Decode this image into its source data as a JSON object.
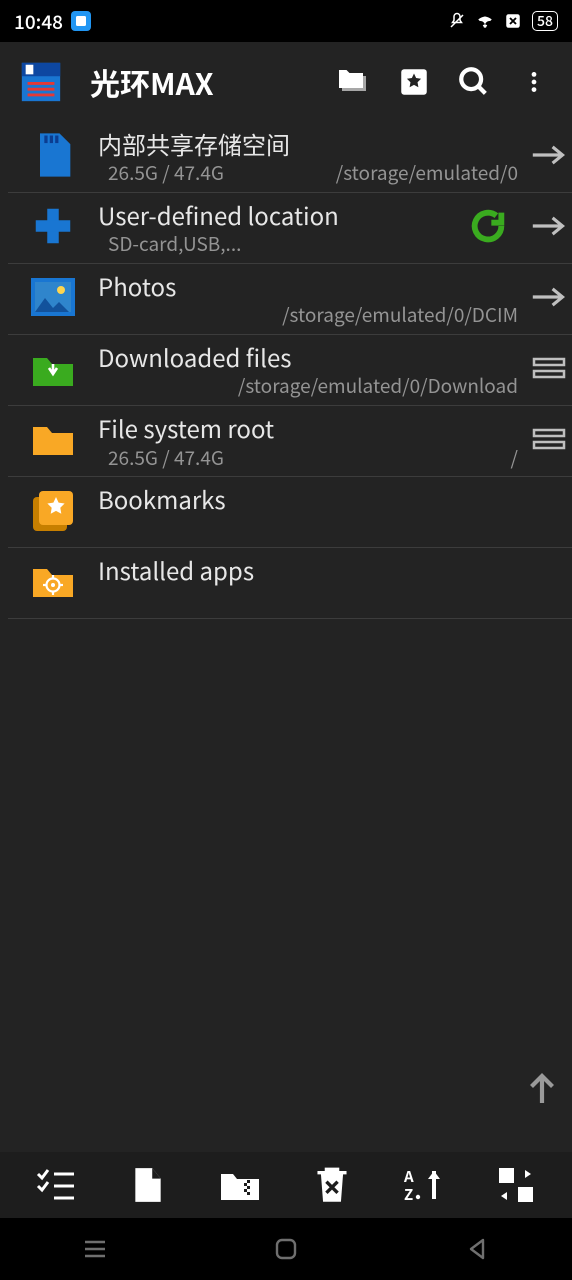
{
  "status": {
    "time": "10:48",
    "battery": "58"
  },
  "header": {
    "title": "光环MAX"
  },
  "rows": [
    {
      "title": "内部共享存储空间",
      "sub_left": "26.5G / 47.4G",
      "sub_right": "/storage/emulated/0"
    },
    {
      "title": "User-defined location",
      "sub_left": "SD-card,USB,...",
      "sub_right": ""
    },
    {
      "title": "Photos",
      "sub_left": "",
      "sub_right": "/storage/emulated/0/DCIM"
    },
    {
      "title": "Downloaded files",
      "sub_left": "",
      "sub_right": "/storage/emulated/0/Download"
    },
    {
      "title": "File system root",
      "sub_left": "26.5G / 47.4G",
      "sub_right": "/"
    },
    {
      "title": "Bookmarks",
      "sub_left": "",
      "sub_right": ""
    },
    {
      "title": "Installed apps",
      "sub_left": "",
      "sub_right": ""
    }
  ]
}
